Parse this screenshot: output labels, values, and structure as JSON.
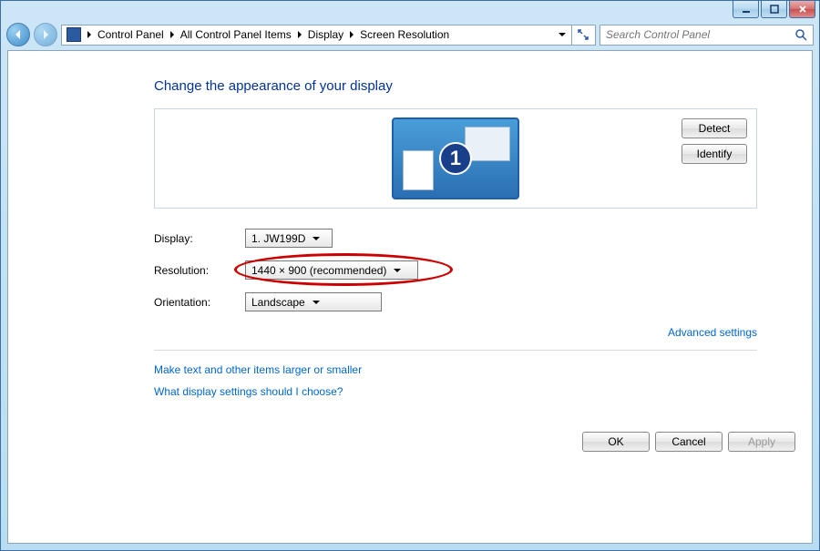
{
  "breadcrumb": {
    "items": [
      "Control Panel",
      "All Control Panel Items",
      "Display",
      "Screen Resolution"
    ]
  },
  "search": {
    "placeholder": "Search Control Panel"
  },
  "heading": "Change the appearance of your display",
  "preview": {
    "detect": "Detect",
    "identify": "Identify",
    "monitor_number": "1"
  },
  "fields": {
    "display_label": "Display:",
    "display_value": "1. JW199D",
    "resolution_label": "Resolution:",
    "resolution_value": "1440 × 900 (recommended)",
    "orientation_label": "Orientation:",
    "orientation_value": "Landscape"
  },
  "links": {
    "advanced": "Advanced settings",
    "larger": "Make text and other items larger or smaller",
    "help": "What display settings should I choose?"
  },
  "buttons": {
    "ok": "OK",
    "cancel": "Cancel",
    "apply": "Apply"
  }
}
